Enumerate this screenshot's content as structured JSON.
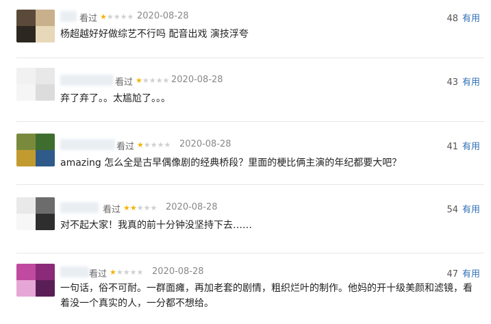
{
  "reviews": [
    {
      "status": "看过",
      "rating": 1,
      "stars": [
        "★",
        "★",
        "★",
        "★",
        "★"
      ],
      "date": "2020-08-28",
      "count": "48",
      "useful_label": "有用",
      "text": "杨超越好好做综艺不行吗 配音出戏 演技浮夸",
      "avatar_colors": [
        "#5b4a3a",
        "#c9b08c",
        "#2c2720",
        "#e7d8b9",
        "#8a6f4a",
        "#d3c3a1"
      ]
    },
    {
      "status": "看过",
      "rating": 1,
      "stars": [
        "★",
        "★",
        "★",
        "★",
        "★"
      ],
      "date": "2020-08-28",
      "count": "43",
      "useful_label": "有用",
      "text": "弃了弃了。。太尴尬了。。。",
      "avatar_colors": [
        "#f1f1f1",
        "#e8e8e8",
        "#f5f5f5",
        "#dcdcdc",
        "#eeeeee",
        "#fafafa"
      ]
    },
    {
      "status": "看过",
      "rating": 1,
      "stars": [
        "★",
        "★",
        "★",
        "★",
        "★"
      ],
      "date": "2020-08-28",
      "count": "41",
      "useful_label": "有用",
      "text": "amazing 怎么全是古早偶像剧的经典桥段？里面的梗比俩主演的年纪都要大吧？",
      "avatar_colors": [
        "#7a8a3c",
        "#3f6d2f",
        "#c29b2f",
        "#2f5a8a",
        "#a76f2c",
        "#6b7f3a"
      ]
    },
    {
      "status": "看过",
      "rating": 2,
      "stars": [
        "★",
        "★",
        "★",
        "★",
        "★"
      ],
      "date": "2020-08-28",
      "count": "54",
      "useful_label": "有用",
      "text": "对不起大家！我真的前十分钟没坚持下去……",
      "avatar_colors": [
        "#e9e9e9",
        "#6c6c6c",
        "#f7f7f7",
        "#2e2e2e",
        "#cfcfcf",
        "#9a9a9a"
      ]
    },
    {
      "status": "看过",
      "rating": 1,
      "stars": [
        "★",
        "★",
        "★",
        "★",
        "★"
      ],
      "date": "2020-08-28",
      "count": "47",
      "useful_label": "有用",
      "text": "一句话，俗不可耐。一群面瘫，再加老套的剧情，粗织烂叶的制作。他妈的开十级美颜和滤镜，看着没一个真实的人，一分都不想给。",
      "avatar_colors": [
        "#c04aa0",
        "#8a2a78",
        "#e6a7d6",
        "#5a1e57",
        "#d070b8",
        "#f2c7e6"
      ]
    }
  ]
}
